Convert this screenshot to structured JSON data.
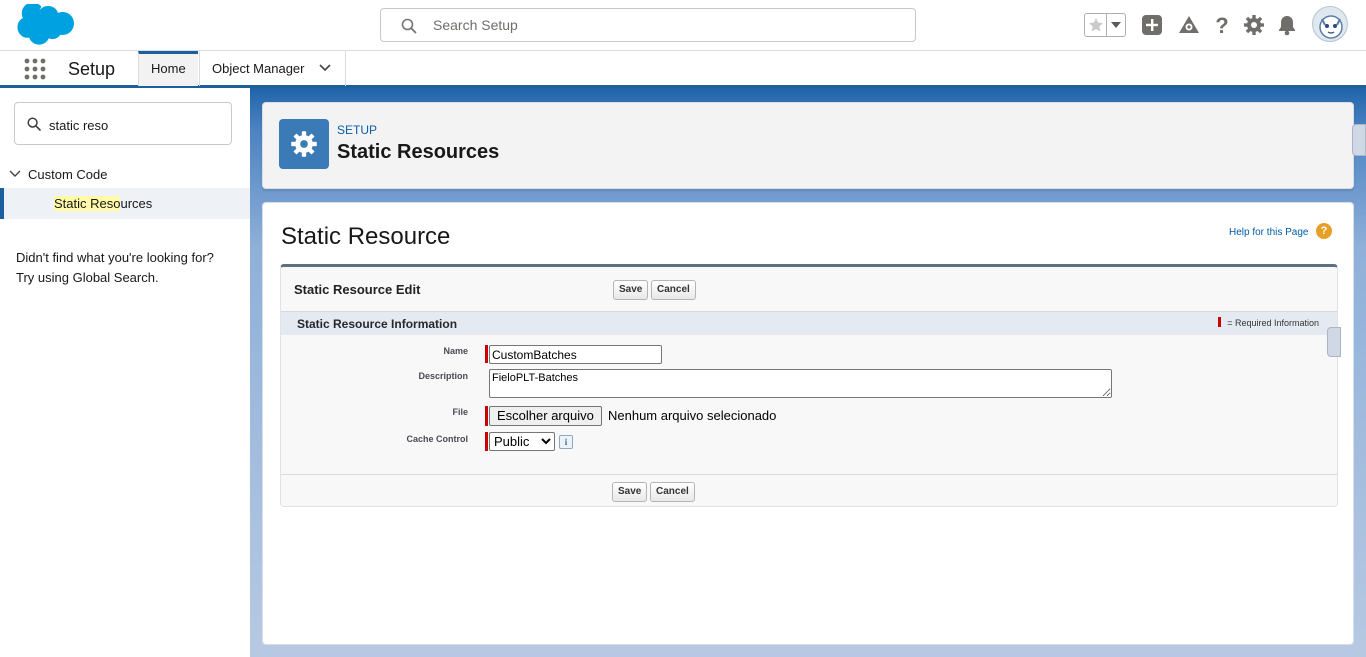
{
  "header": {
    "search_placeholder": "Search Setup",
    "icons": [
      "star-icon",
      "chevron-down-icon",
      "plus-icon",
      "trailhead-icon",
      "help-icon",
      "gear-icon",
      "bell-icon",
      "avatar"
    ]
  },
  "nav": {
    "app_name": "Setup",
    "tabs": [
      {
        "label": "Home",
        "active": true
      },
      {
        "label": "Object Manager",
        "active": false
      }
    ]
  },
  "sidebar": {
    "quickfind_value": "static reso",
    "tree": {
      "node_label": "Custom Code",
      "leaf_highlight": "Static Reso",
      "leaf_rest": "urces"
    },
    "not_found_line1": "Didn't find what you're looking for?",
    "not_found_line2": "Try using Global Search."
  },
  "page_header": {
    "eyebrow": "SETUP",
    "title": "Static Resources"
  },
  "main": {
    "title": "Static Resource",
    "help_link": "Help for this Page",
    "help_icon": "?",
    "block_title": "Static Resource Edit",
    "save_label": "Save",
    "cancel_label": "Cancel",
    "section_title": "Static Resource Information",
    "required_legend": "= Required Information",
    "fields": {
      "name_label": "Name",
      "name_value": "CustomBatches",
      "description_label": "Description",
      "description_value": "FieloPLT-Batches",
      "file_label": "File",
      "file_button": "Escolher arquivo",
      "file_status": "Nenhum arquivo selecionado",
      "cache_label": "Cache Control",
      "cache_value": "Public",
      "info_icon": "i"
    }
  },
  "colors": {
    "brand": "#00a1e0",
    "accent": "#1b5f9e",
    "required": "#cc0000"
  }
}
